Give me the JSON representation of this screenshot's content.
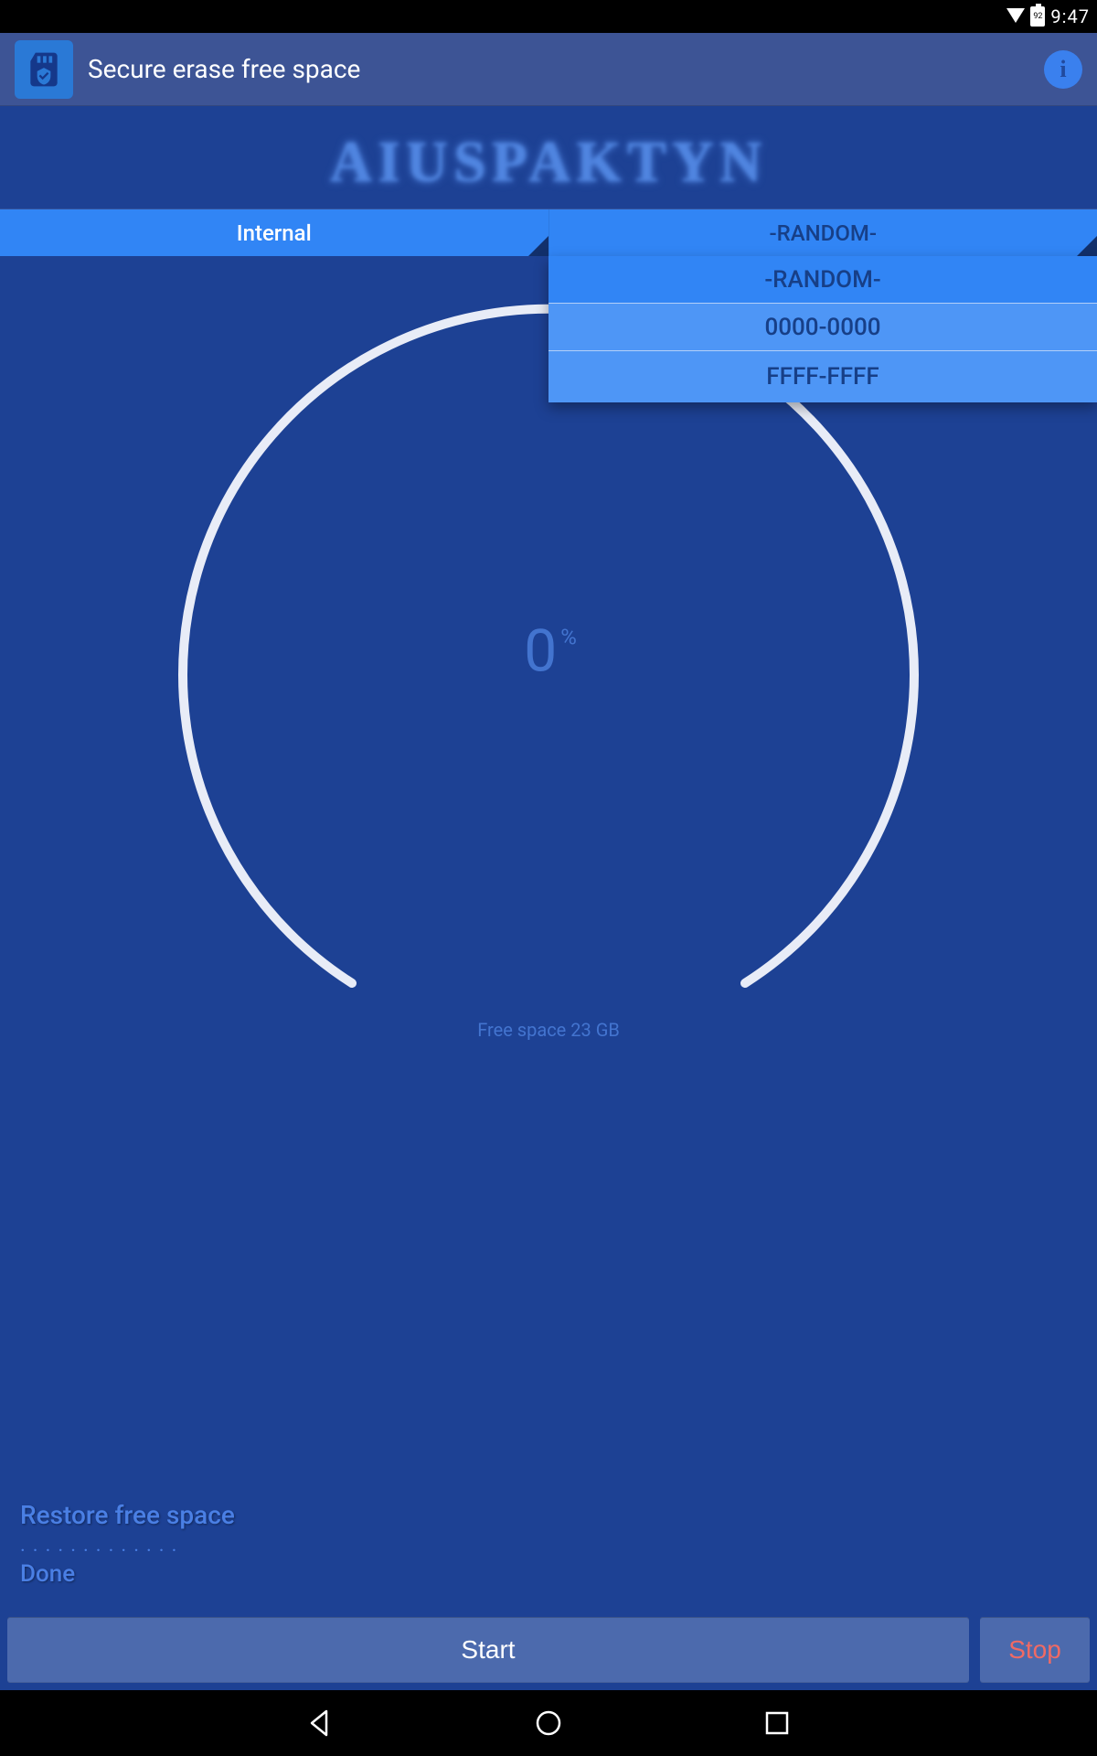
{
  "status_bar": {
    "battery": "92",
    "time": "9:47"
  },
  "app_bar": {
    "title": "Secure erase free space"
  },
  "brand": "AIUSPAKTYN",
  "spinners": {
    "storage": "Internal",
    "pattern": "-RANDOM-",
    "pattern_options": [
      "-RANDOM-",
      "0000-0000",
      "FFFF-FFFF"
    ]
  },
  "progress": {
    "pct": "0",
    "symbol": "%",
    "free_space": "Free space 23 GB"
  },
  "status_text": {
    "restore": "Restore free space",
    "done": "Done"
  },
  "buttons": {
    "start": "Start",
    "stop": "Stop"
  }
}
